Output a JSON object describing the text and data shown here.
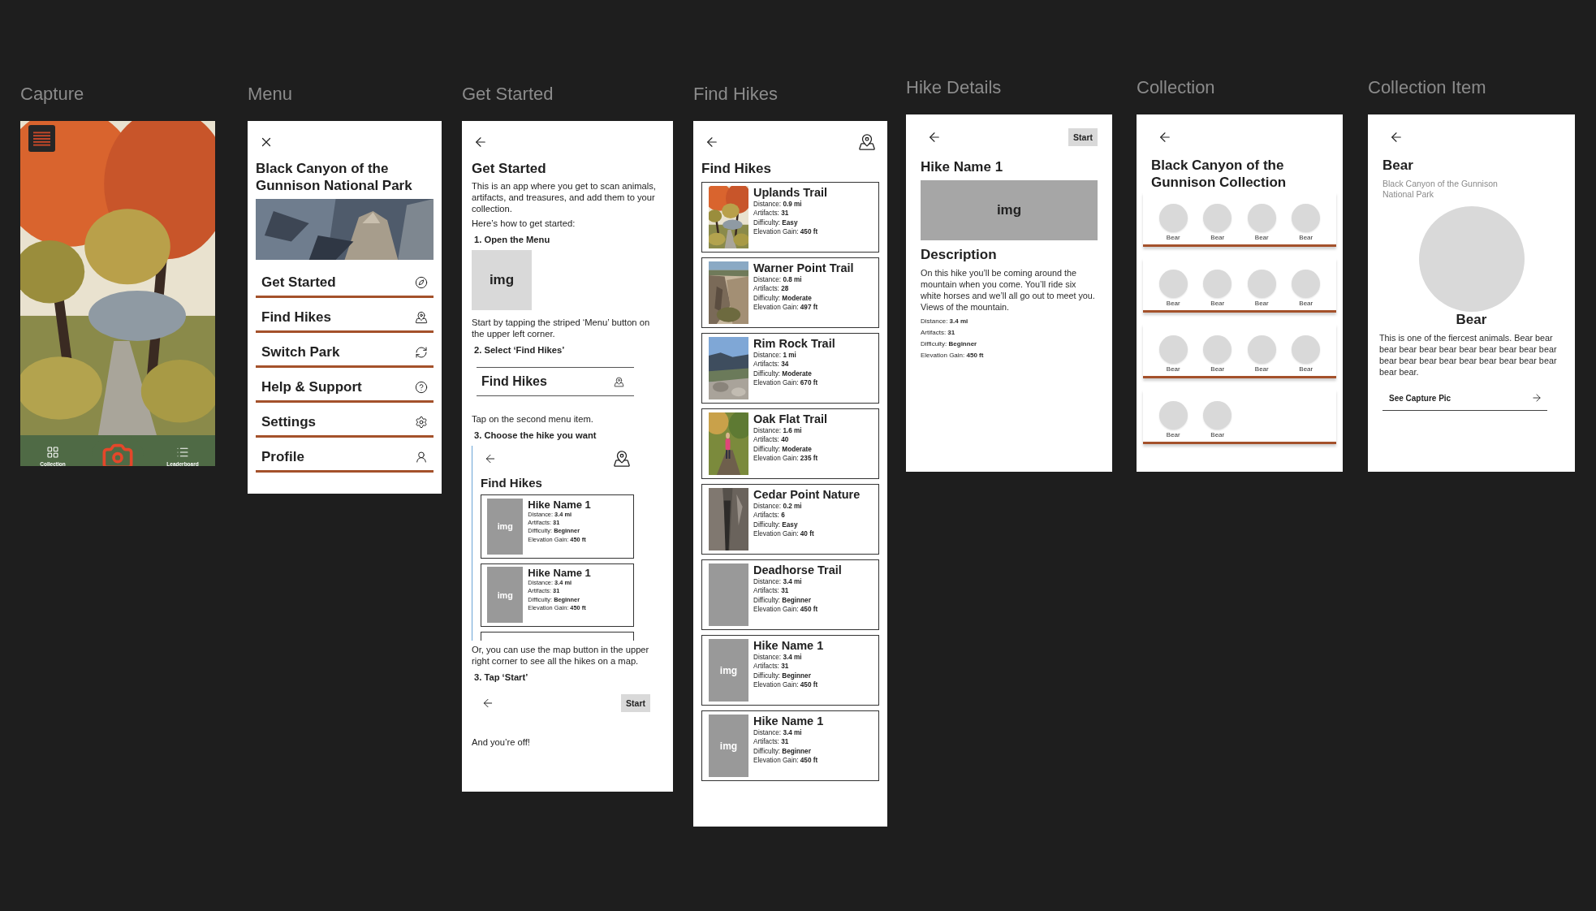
{
  "frames": [
    {
      "kind": "capture",
      "label": "Capture",
      "picture": {
        "kind": "picture"
      },
      "nav": [
        {
          "label": "Collection"
        },
        {
          "label": "Leaderboard"
        }
      ]
    },
    {
      "kind": "menu",
      "label": "Menu",
      "title": "Black Canyon of the Gunnison National Park",
      "picture": {
        "kind": "picture"
      },
      "items": [
        {
          "label": "Get Started"
        },
        {
          "label": "Find Hikes"
        },
        {
          "label": "Switch Park"
        },
        {
          "label": "Help & Support"
        },
        {
          "label": "Settings"
        },
        {
          "label": "Profile"
        }
      ]
    },
    {
      "kind": "get_started",
      "label": "Get Started",
      "blocks": [
        {
          "kind": "heading",
          "text": "Get Started"
        },
        {
          "kind": "paragraph",
          "text": "This is an app where you get to scan animals, artifacts, and treasures, and add them to your collection."
        },
        {
          "kind": "paragraph",
          "text": "Here’s how to get started:"
        },
        {
          "kind": "step",
          "text": "1. Open the Menu"
        },
        {
          "text": "img"
        },
        {
          "kind": "paragraph",
          "text": "Start by tapping the striped ‘Menu’ button on the upper left corner."
        },
        {
          "kind": "step",
          "text": "2. Select ‘Find Hikes’"
        },
        {
          "kind": "menu_snippet",
          "items": [
            {
              "label": "Find Hikes"
            }
          ]
        },
        {
          "kind": "paragraph",
          "text": "Tap on the second menu item."
        },
        {
          "kind": "step",
          "text": "3. Choose the hike you want"
        },
        {
          "kind": "hikes_snippet",
          "title": "Find Hikes",
          "more_below": true,
          "hikes": [
            {
              "name": "Hike Name 1",
              "image": {
                "kind": "placeholder",
                "text": "img"
              },
              "details": [
                "Distance: **3.4 mi**",
                "Artifacts: **31**",
                "Difficulty: **Beginner**",
                "Elevation Gain: **450 ft**"
              ]
            },
            {
              "name": "Hike Name 1",
              "image": {
                "kind": "placeholder",
                "text": "img"
              },
              "details": [
                "Distance: **3.4 mi**",
                "Artifacts: **31**",
                "Difficulty: **Beginner**",
                "Elevation Gain: **450 ft**"
              ]
            }
          ]
        },
        {
          "kind": "paragraph",
          "text": "Or, you can use the map button in the upper right corner to see all the hikes on a map."
        },
        {
          "kind": "step",
          "text": "3. Tap ‘Start’"
        },
        {
          "kind": "start_snippet",
          "button": "Start"
        },
        {
          "kind": "paragraph",
          "text": "And you’re off!"
        }
      ]
    },
    {
      "kind": "find_hikes",
      "label": "Find Hikes",
      "title": "Find Hikes",
      "hikes": [
        {
          "name": "Uplands Trail",
          "image": {
            "kind": "picture"
          },
          "details": [
            "Distance: **0.9 mi**",
            "Artifacts: **31**",
            "Difficulty: **Easy**",
            "Elevation Gain: **450 ft**"
          ]
        },
        {
          "name": "Warner Point Trail",
          "image": {
            "kind": "picture"
          },
          "details": [
            "Distance: **0.8 mi**",
            "Artifacts: **28**",
            "Difficulty: **Moderate**",
            "Elevation Gain: **497 ft**"
          ]
        },
        {
          "name": "Rim Rock Trail",
          "image": {
            "kind": "picture"
          },
          "details": [
            "Distance: **1 mi**",
            "Artifacts: **34**",
            "Difficulty: **Moderate**",
            "Elevation Gain: **670 ft**"
          ]
        },
        {
          "name": "Oak Flat Trail",
          "image": {
            "kind": "picture"
          },
          "details": [
            "Distance: **1.6 mi**",
            "Artifacts: **40**",
            "Difficulty: **Moderate**",
            "Elevation Gain: **235 ft**"
          ]
        },
        {
          "name": "Cedar Point Nature",
          "image": {
            "kind": "picture"
          },
          "details": [
            "Distance: **0.2 mi**",
            "Artifacts: **6**",
            "Difficulty: **Easy**",
            "Elevation Gain: **40 ft**"
          ]
        },
        {
          "name": "Deadhorse Trail",
          "image": {
            "kind": "placeholder"
          },
          "details": [
            "Distance: **3.4 mi**",
            "Artifacts: **31**",
            "Difficulty: **Beginner**",
            "Elevation Gain: **450 ft**"
          ]
        },
        {
          "name": "Hike Name 1",
          "image": {
            "kind": "placeholder",
            "text": "img"
          },
          "details": [
            "Distance: **3.4 mi**",
            "Artifacts: **31**",
            "Difficulty: **Beginner**",
            "Elevation Gain: **450 ft**"
          ]
        },
        {
          "name": "Hike Name 1",
          "image": {
            "kind": "placeholder",
            "text": "img"
          },
          "details": [
            "Distance: **3.4 mi**",
            "Artifacts: **31**",
            "Difficulty: **Beginner**",
            "Elevation Gain: **450 ft**"
          ]
        }
      ]
    },
    {
      "kind": "hike_details",
      "label": "Hike Details",
      "button": "Start",
      "title": "Hike Name 1",
      "image": "img",
      "heading": "Description",
      "text": "On this hike you’ll be coming around the mountain when you come. You’ll ride six white horses and we’ll all go out to meet you. Views of the mountain.",
      "details": [
        "Distance: **3.4 mi**",
        "Artifacts: **31**",
        "Difficulty: **Beginner**",
        "Elevation Gain: **450 ft**"
      ]
    },
    {
      "kind": "collection",
      "label": "Collection",
      "title": "Black Canyon of the Gunnison Collection",
      "items": [
        {
          "label": "Bear"
        },
        {
          "label": "Bear"
        },
        {
          "label": "Bear"
        },
        {
          "label": "Bear"
        },
        {
          "label": "Bear"
        },
        {
          "label": "Bear"
        },
        {
          "label": "Bear"
        },
        {
          "label": "Bear"
        },
        {
          "label": "Bear"
        },
        {
          "label": "Bear"
        },
        {
          "label": "Bear"
        },
        {
          "label": "Bear"
        },
        {
          "label": "Bear"
        },
        {
          "label": "Bear"
        }
      ]
    },
    {
      "kind": "collection_item",
      "label": "Collection Item",
      "title": "Bear",
      "subtitle": "Black Canyon of the Gunnison National Park",
      "name": "Bear",
      "text": "This is one of the fiercest animals. Bear bear bear bear bear bear bear bear bear bear bear bear bear bear bear bear bear bear bear bear bear bear.",
      "link": "See Capture Pic"
    }
  ]
}
